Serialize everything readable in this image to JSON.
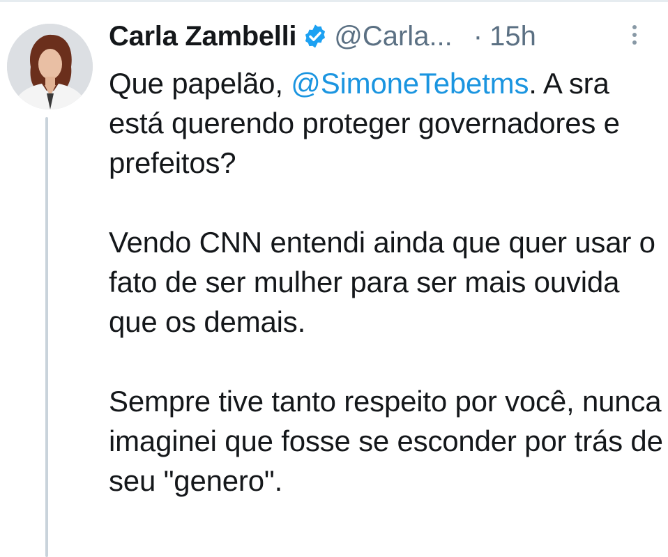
{
  "tweet": {
    "display_name": "Carla Zambelli",
    "verified_icon": "verified-badge-icon",
    "handle": "@Carla...",
    "separator": "·",
    "time": "15h",
    "more_icon": "more-options-icon",
    "paragraphs": [
      {
        "before": "Que papelão, ",
        "mention": "@SimoneTebetms",
        "after": ". A sra está querendo proteger governadores e prefeitos?"
      },
      {
        "text": "Vendo CNN entendi ainda que quer usar o fato de ser mulher para ser mais ouvida que os demais."
      },
      {
        "text": "Sempre tive tanto respeito por você, nunca imaginei que fosse se esconder por trás de seu \"genero\"."
      }
    ]
  },
  "colors": {
    "text": "#14171a",
    "secondary": "#5b7083",
    "link": "#1b95e0",
    "verified": "#1da1f2",
    "thread_line": "#c9d3db"
  }
}
